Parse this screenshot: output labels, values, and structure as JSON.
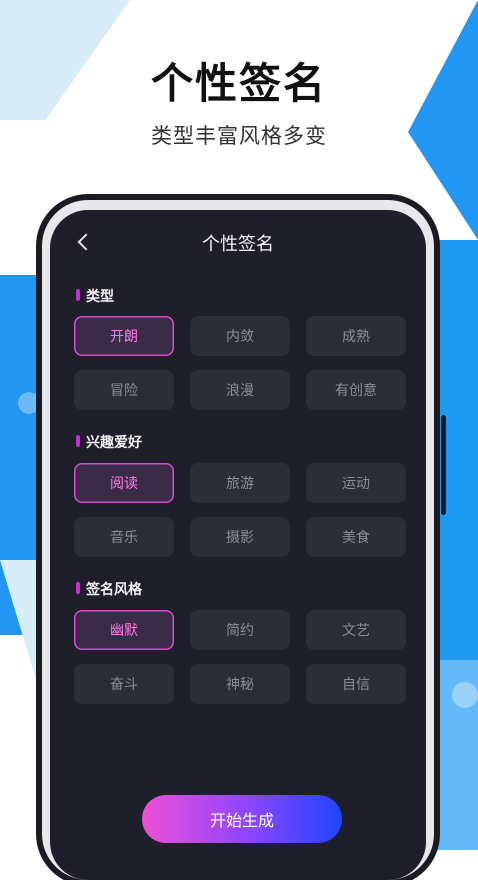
{
  "hero": {
    "title": "个性签名",
    "subtitle": "类型丰富风格多变"
  },
  "nav": {
    "title": "个性签名"
  },
  "sections": [
    {
      "label": "类型",
      "options": [
        "开朗",
        "内敛",
        "成熟",
        "冒险",
        "浪漫",
        "有创意"
      ],
      "selected": "开朗"
    },
    {
      "label": "兴趣爱好",
      "options": [
        "阅读",
        "旅游",
        "运动",
        "音乐",
        "摄影",
        "美食"
      ],
      "selected": "阅读"
    },
    {
      "label": "签名风格",
      "options": [
        "幽默",
        "简约",
        "文艺",
        "奋斗",
        "神秘",
        "自信"
      ],
      "selected": "幽默"
    }
  ],
  "action": {
    "label": "开始生成"
  },
  "colors": {
    "accent_pink": "#ff7ce6",
    "accent_border": "#d54ed2",
    "section_mark": "#c62bd6",
    "screen_bg": "#1e1f2a",
    "chip_bg": "#2c2d38",
    "bg_blue": "#2196f3"
  }
}
